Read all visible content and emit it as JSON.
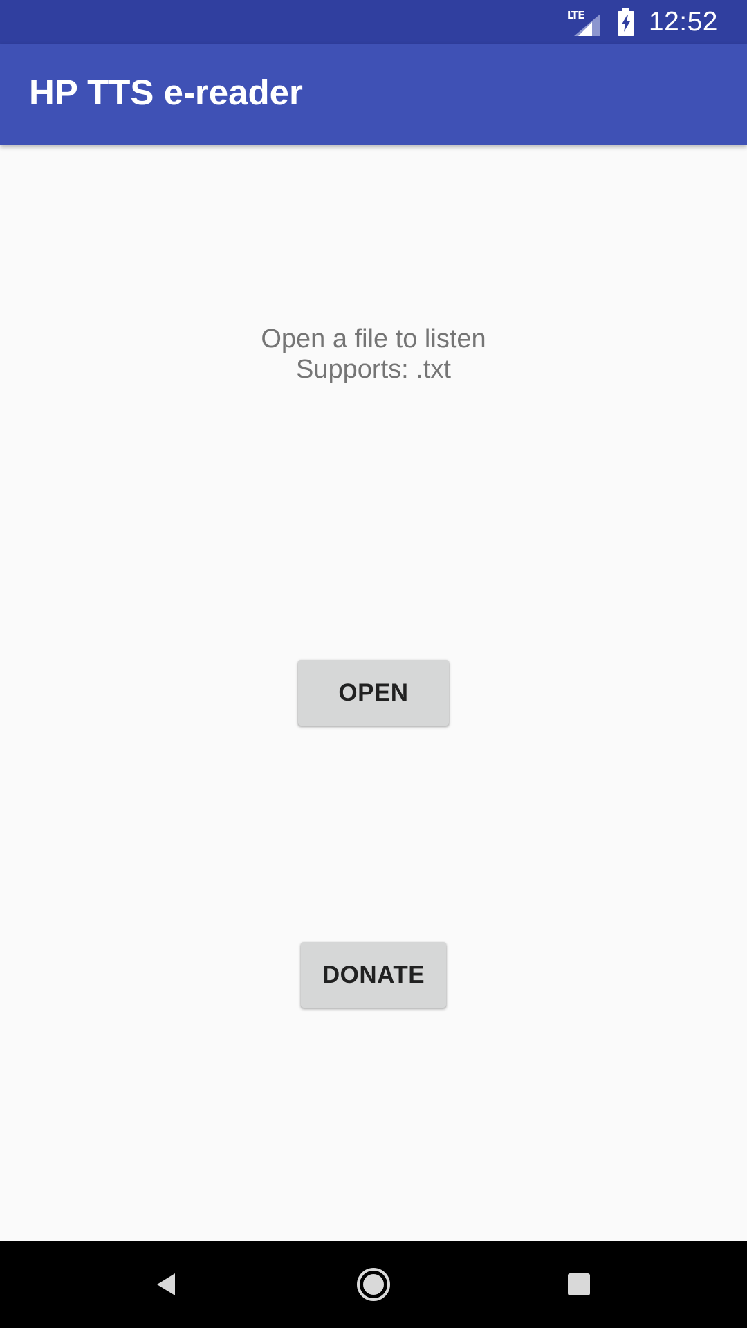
{
  "status_bar": {
    "network_label": "LTE",
    "time": "12:52",
    "icons": [
      "lte-signal-icon",
      "battery-charging-icon"
    ],
    "color": "#303f9f"
  },
  "app_bar": {
    "title": "HP TTS e-reader",
    "color": "#3f51b5"
  },
  "main": {
    "prompt_line1": "Open a file to listen",
    "prompt_line2": "Supports: .txt",
    "open_label": "OPEN",
    "donate_label": "DONATE"
  },
  "nav_bar": {
    "icons": [
      "back-icon",
      "home-icon",
      "recents-icon"
    ]
  }
}
